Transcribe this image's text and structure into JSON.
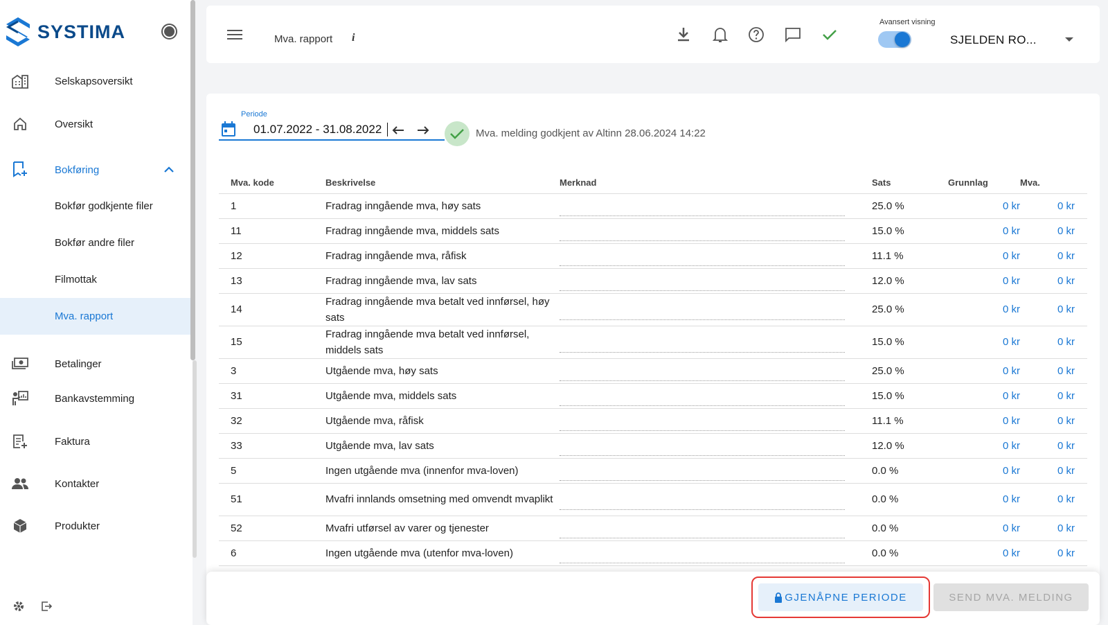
{
  "app": {
    "name": "SYSTIMA"
  },
  "sidebar": {
    "items": [
      {
        "label": "Selskapsoversikt",
        "icon": "building-icon"
      },
      {
        "label": "Oversikt",
        "icon": "home-icon"
      },
      {
        "label": "Bokføring",
        "icon": "bookmark-add-icon"
      },
      {
        "label": "Bokfør godkjente filer"
      },
      {
        "label": "Bokfør andre filer"
      },
      {
        "label": "Filmottak"
      },
      {
        "label": "Mva. rapport"
      },
      {
        "label": "Betalinger",
        "icon": "money-icon"
      },
      {
        "label": "Bankavstemming",
        "icon": "presentation-icon"
      },
      {
        "label": "Faktura",
        "icon": "invoice-add-icon"
      },
      {
        "label": "Kontakter",
        "icon": "people-icon"
      },
      {
        "label": "Produkter",
        "icon": "box-icon"
      }
    ]
  },
  "header": {
    "title": "Mva. rapport",
    "info": "i",
    "advanced_label": "Avansert visning",
    "company": "SJELDEN RO..."
  },
  "period": {
    "label": "Periode",
    "value": "01.07.2022 - 31.08.2022",
    "status": "Mva. melding godkjent av Altinn 28.06.2024 14:22"
  },
  "table": {
    "headers": [
      "Mva. kode",
      "Beskrivelse",
      "Merknad",
      "Sats",
      "Grunnlag",
      "Mva."
    ],
    "rows": [
      {
        "kode": "1",
        "beskrivelse": "Fradrag inngående mva, høy sats",
        "sats": "25.0 %",
        "grunnlag": "0 kr",
        "mva": "0 kr"
      },
      {
        "kode": "11",
        "beskrivelse": "Fradrag inngående mva, middels sats",
        "sats": "15.0 %",
        "grunnlag": "0 kr",
        "mva": "0 kr"
      },
      {
        "kode": "12",
        "beskrivelse": "Fradrag inngående mva, råfisk",
        "sats": "11.1 %",
        "grunnlag": "0 kr",
        "mva": "0 kr"
      },
      {
        "kode": "13",
        "beskrivelse": "Fradrag inngående mva, lav sats",
        "sats": "12.0 %",
        "grunnlag": "0 kr",
        "mva": "0 kr"
      },
      {
        "kode": "14",
        "beskrivelse": "Fradrag inngående mva betalt ved innførsel, høy sats",
        "sats": "25.0 %",
        "grunnlag": "0 kr",
        "mva": "0 kr"
      },
      {
        "kode": "15",
        "beskrivelse": "Fradrag inngående mva betalt ved innførsel, middels sats",
        "sats": "15.0 %",
        "grunnlag": "0 kr",
        "mva": "0 kr"
      },
      {
        "kode": "3",
        "beskrivelse": "Utgående mva, høy sats",
        "sats": "25.0 %",
        "grunnlag": "0 kr",
        "mva": "0 kr"
      },
      {
        "kode": "31",
        "beskrivelse": "Utgående mva, middels sats",
        "sats": "15.0 %",
        "grunnlag": "0 kr",
        "mva": "0 kr"
      },
      {
        "kode": "32",
        "beskrivelse": "Utgående mva, råfisk",
        "sats": "11.1 %",
        "grunnlag": "0 kr",
        "mva": "0 kr"
      },
      {
        "kode": "33",
        "beskrivelse": "Utgående mva, lav sats",
        "sats": "12.0 %",
        "grunnlag": "0 kr",
        "mva": "0 kr"
      },
      {
        "kode": "5",
        "beskrivelse": "Ingen utgående mva (innenfor mva-loven)",
        "sats": "0.0 %",
        "grunnlag": "0 kr",
        "mva": "0 kr"
      },
      {
        "kode": "51",
        "beskrivelse": "Mvafri innlands omsetning med omvendt mvaplikt",
        "sats": "0.0 %",
        "grunnlag": "0 kr",
        "mva": "0 kr"
      },
      {
        "kode": "52",
        "beskrivelse": "Mvafri utførsel av varer og tjenester",
        "sats": "0.0 %",
        "grunnlag": "0 kr",
        "mva": "0 kr"
      },
      {
        "kode": "6",
        "beskrivelse": "Ingen utgående mva (utenfor mva-loven)",
        "sats": "0.0 %",
        "grunnlag": "0 kr",
        "mva": "0 kr"
      }
    ]
  },
  "footer": {
    "reopen_label": "GJENÅPNE PERIODE",
    "send_label": "SEND MVA. MELDING"
  },
  "colors": {
    "accent": "#1a78d4",
    "success": "#43a047",
    "highlight": "#e53935"
  }
}
